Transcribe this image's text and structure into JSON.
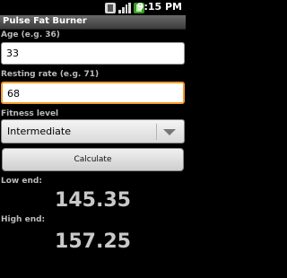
{
  "statusbar": {
    "time": "9:15 PM",
    "icons": [
      "sim-icon",
      "signal-icon",
      "battery-icon"
    ]
  },
  "app": {
    "title": "Pulse Fat Burner"
  },
  "age": {
    "label": "Age (e.g. 36)",
    "value": "33"
  },
  "resting": {
    "label": "Resting rate (e.g. 71)",
    "value": "68"
  },
  "fitness": {
    "label": "Fitness level",
    "selected": "Intermediate"
  },
  "calculate": {
    "label": "Calculate"
  },
  "results": {
    "low_label": "Low end:",
    "low_value": "145.35",
    "high_label": "High end:",
    "high_value": "157.25"
  },
  "colors": {
    "focus": "#f29b2a",
    "background": "#000000"
  }
}
